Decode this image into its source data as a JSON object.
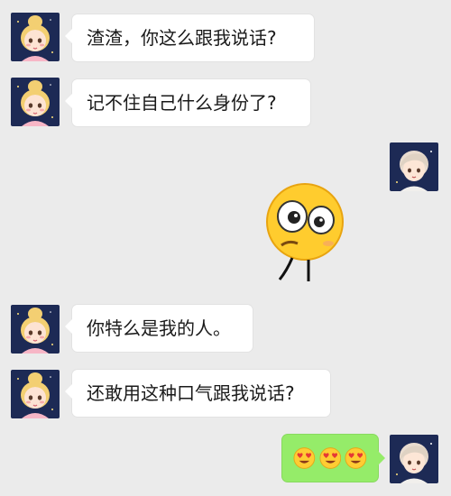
{
  "messages": [
    {
      "side": "left",
      "text": "渣渣，你这么跟我说话?"
    },
    {
      "side": "left",
      "text": "记不住自己什么身份了?"
    },
    {
      "side": "right",
      "sticker": "shocked-face-sticker"
    },
    {
      "side": "left",
      "text": "你特么是我的人。"
    },
    {
      "side": "left",
      "text": "还敢用这种口气跟我说话?"
    },
    {
      "side": "right",
      "emojis": [
        "heart-eyes-emoji",
        "heart-eyes-emoji",
        "heart-eyes-emoji"
      ]
    }
  ],
  "colors": {
    "background": "#ebebeb",
    "received_bubble": "#ffffff",
    "sent_bubble": "#95ec69"
  }
}
